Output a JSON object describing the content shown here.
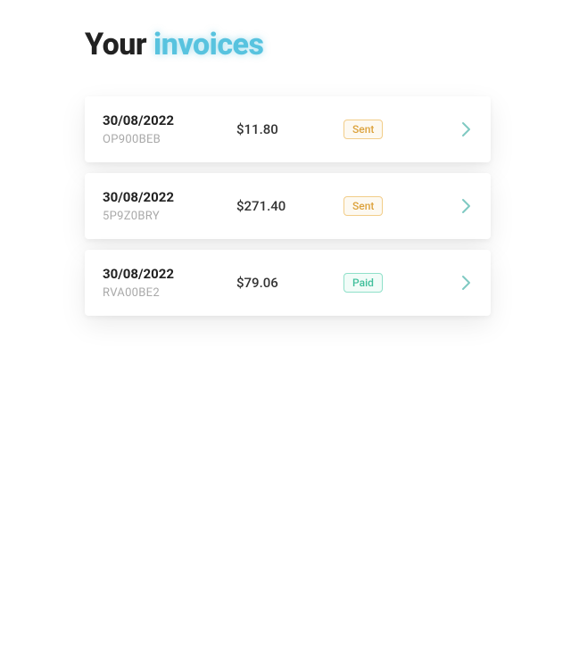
{
  "title": {
    "prefix": "Your ",
    "accent": "invoices"
  },
  "status_labels": {
    "sent": "Sent",
    "paid": "Paid"
  },
  "invoices": [
    {
      "date": "30/08/2022",
      "code": "OP900BEB",
      "amount": "$11.80",
      "status": "sent"
    },
    {
      "date": "30/08/2022",
      "code": "5P9Z0BRY",
      "amount": "$271.40",
      "status": "sent"
    },
    {
      "date": "30/08/2022",
      "code": "RVA00BE2",
      "amount": "$79.06",
      "status": "paid"
    }
  ]
}
